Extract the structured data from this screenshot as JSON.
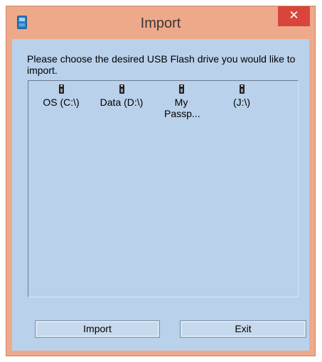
{
  "window": {
    "title": "Import",
    "close_symbol": "✕"
  },
  "dialog": {
    "instructions": "Please choose the desired USB Flash drive you would like to import."
  },
  "drives": [
    {
      "label": "OS (C:\\)",
      "icon": "usb-drive-icon"
    },
    {
      "label": "Data (D:\\)",
      "icon": "usb-drive-icon"
    },
    {
      "label": "My Passp...",
      "icon": "usb-drive-icon"
    },
    {
      "label": "(J:\\)",
      "icon": "usb-drive-icon"
    }
  ],
  "buttons": {
    "import_label": "Import",
    "exit_label": "Exit"
  },
  "colors": {
    "titlebar": "#eea98b",
    "close_button": "#d9453b",
    "client_background": "#b9d1ea"
  }
}
